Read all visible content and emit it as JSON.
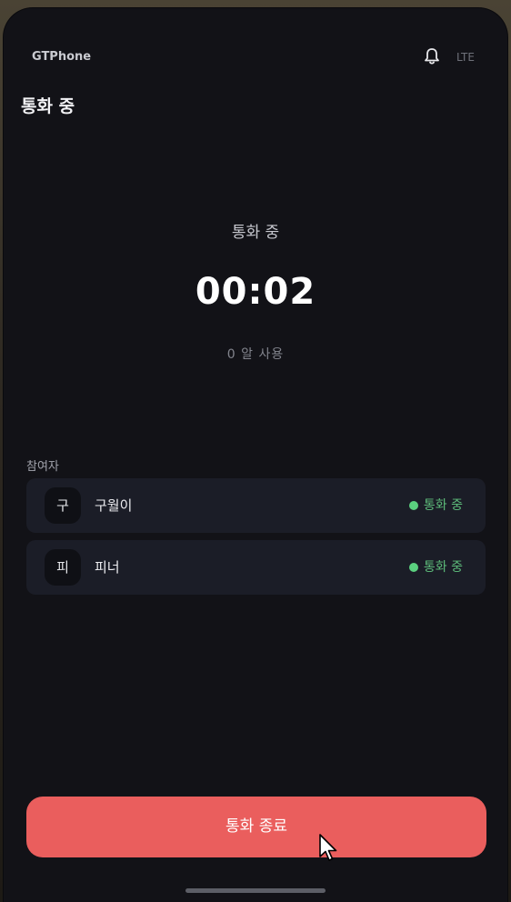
{
  "status_bar": {
    "brand": "GTPhone",
    "network": "LTE",
    "icons": [
      "bell-icon"
    ]
  },
  "header": {
    "title": "통화 중"
  },
  "call": {
    "status": "통화 중",
    "timer": "00:02",
    "usage": "0 알 사용"
  },
  "participants": {
    "label": "참여자",
    "items": [
      {
        "initial": "구",
        "name": "구월이",
        "status": "통화 중"
      },
      {
        "initial": "피",
        "name": "피너",
        "status": "통화 중"
      }
    ]
  },
  "actions": {
    "end_call_label": "통화 종료"
  },
  "colors": {
    "background": "#121217",
    "card": "#1b1d27",
    "status_green": "#5bd07f",
    "end_call_red": "#ea5e5d"
  }
}
